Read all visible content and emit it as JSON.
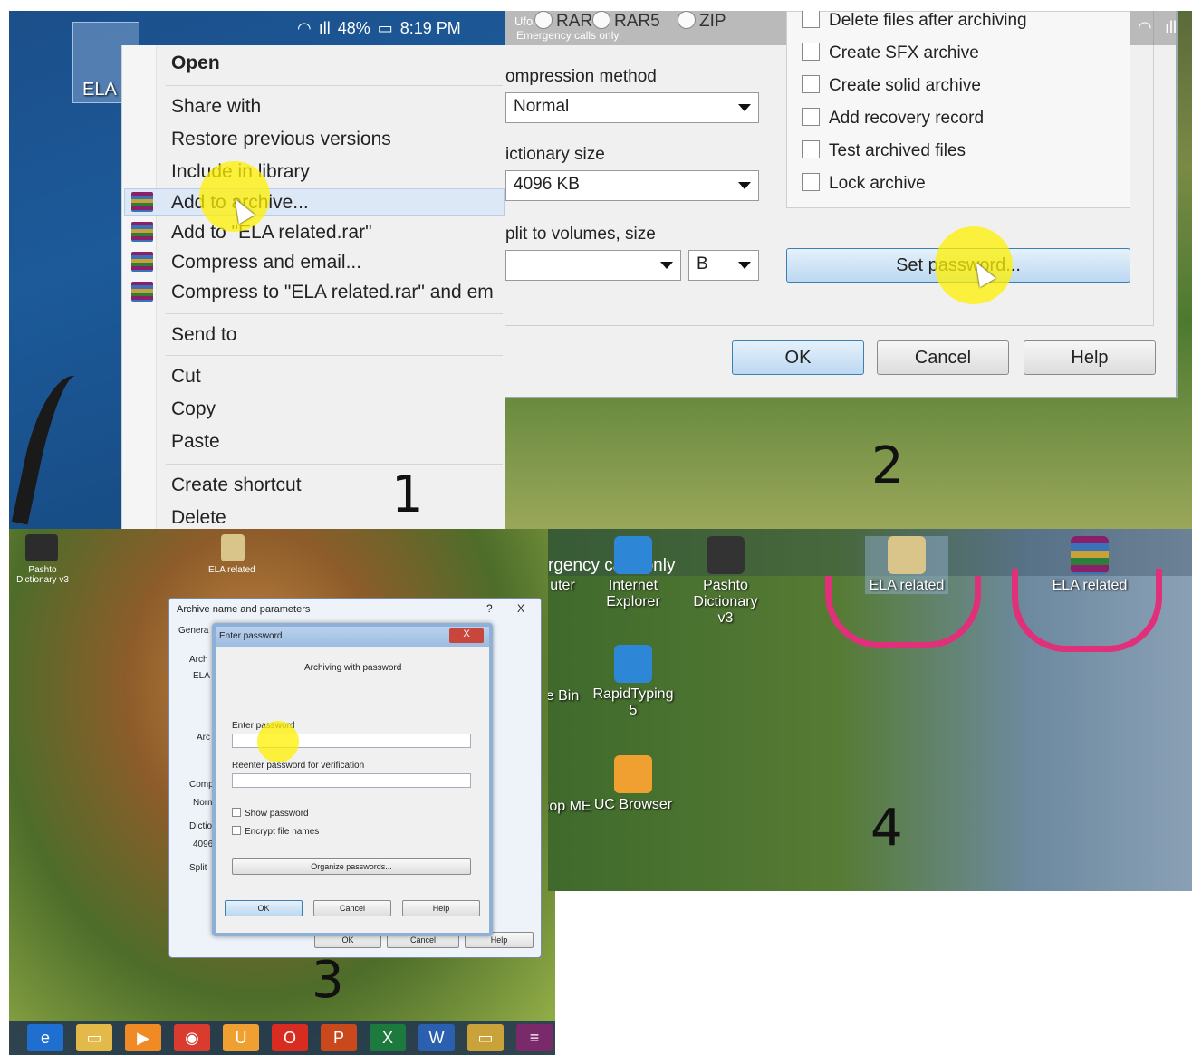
{
  "panel1": {
    "status": {
      "signal": "ıll",
      "pct": "48%",
      "time": "8:19 PM"
    },
    "desktop_icon_label": "ELA",
    "menu": {
      "open": "Open",
      "share": "Share with",
      "restore": "Restore previous versions",
      "library": "Include in library",
      "add_archive": "Add to archive...",
      "add_to_rar": "Add to \"ELA related.rar\"",
      "compress_email": "Compress and email...",
      "compress_to_rar_email": "Compress to \"ELA related.rar\" and em",
      "send_to": "Send to",
      "cut": "Cut",
      "copy": "Copy",
      "paste": "Paste",
      "create_shortcut": "Create shortcut",
      "delete": "Delete"
    },
    "number": "1"
  },
  "panel2": {
    "status": {
      "carrier": "Ufone",
      "emergency": "Emergency calls only"
    },
    "formats": [
      "RAR",
      "RAR5",
      "ZIP"
    ],
    "compression_label": "ompression method",
    "compression_value": "Normal",
    "dict_label": "ictionary size",
    "dict_value": "4096 KB",
    "split_label": "plit to volumes, size",
    "split_unit": "B",
    "options": [
      "Delete files after archiving",
      "Create SFX archive",
      "Create solid archive",
      "Add recovery record",
      "Test archived files",
      "Lock archive"
    ],
    "set_password": "Set password...",
    "ok": "OK",
    "cancel": "Cancel",
    "help": "Help",
    "number": "2"
  },
  "panel3": {
    "desk_icon1": "Pashto Dictionary v3",
    "desk_icon2": "ELA related",
    "archive_title": "Archive name and parameters",
    "q": "?",
    "x": "X",
    "tab_general": "Genera",
    "arch_label": "Arch",
    "arch_value": "ELA",
    "arc2": "Arc",
    "comp_label": "Comp",
    "comp_value": "Norm",
    "dict_label": "Dictio",
    "dict_value": "4096",
    "split_label": "Split",
    "pwd_title": "Enter password",
    "pwd_close": "X",
    "archiving_with": "Archiving with password",
    "enter_pwd": "Enter password",
    "reenter_pwd": "Reenter password for verification",
    "show_pwd": "Show password",
    "encrypt_names": "Encrypt file names",
    "organize": "Organize passwords...",
    "ok": "OK",
    "cancel": "Cancel",
    "help": "Help",
    "outer_ok": "OK",
    "outer_cancel": "Cancel",
    "outer_help": "Help",
    "number": "3"
  },
  "panel4": {
    "emergency": "rgency calls only",
    "icons": {
      "uter": "uter",
      "ie": "Internet Explorer",
      "pashto": "Pashto Dictionary v3",
      "ela_folder": "ELA related",
      "ela_rar": "ELA related",
      "bin": "e Bin",
      "rapid": "RapidTyping 5",
      "shop": "shop ME",
      "uc": "UC Browser"
    },
    "number": "4"
  },
  "colors": {
    "highlight": "#ffee00",
    "annotation": "#e0307a",
    "selection": "#dde8f6"
  }
}
